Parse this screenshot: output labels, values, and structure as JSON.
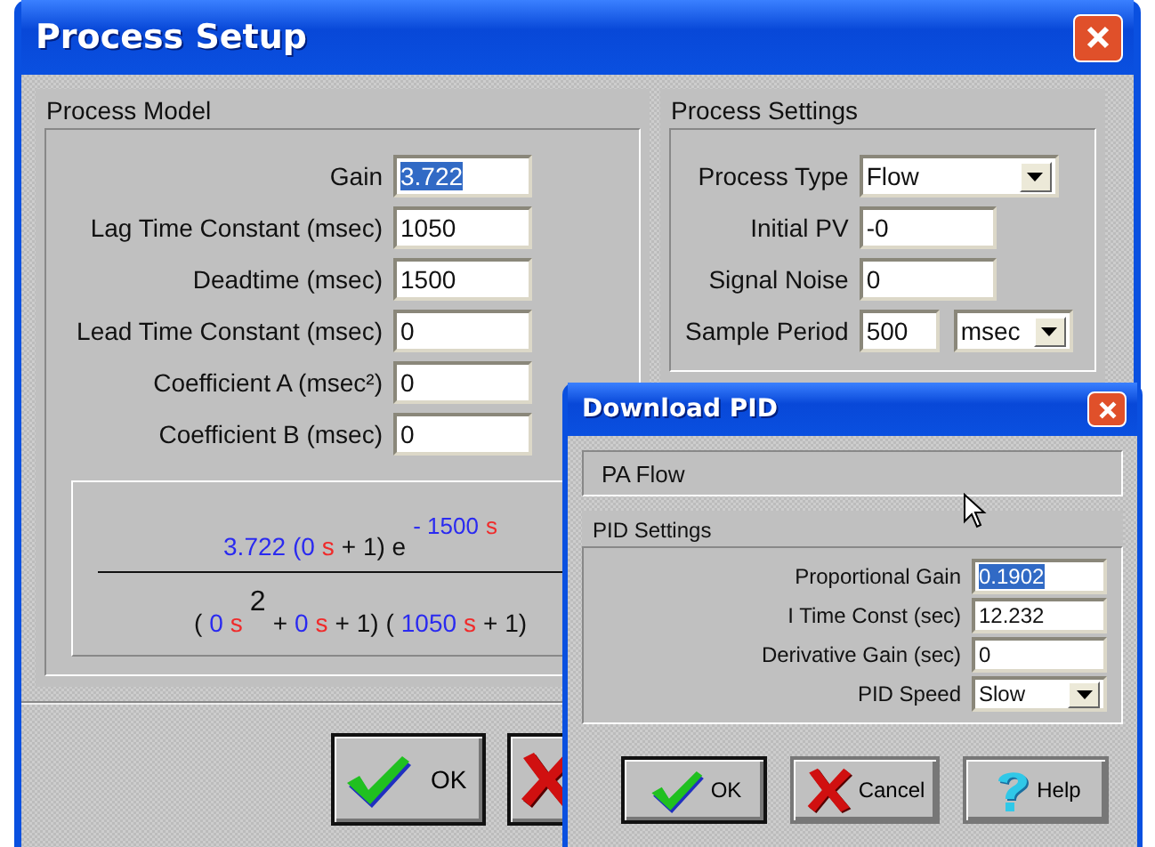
{
  "window": {
    "title": "Process Setup"
  },
  "process_model": {
    "title": "Process Model",
    "fields": [
      {
        "label": "Gain",
        "value": "3.722",
        "selected": true
      },
      {
        "label": "Lag Time Constant (msec)",
        "value": "1050",
        "selected": false
      },
      {
        "label": "Deadtime (msec)",
        "value": "1500",
        "selected": false
      },
      {
        "label": "Lead Time Constant (msec)",
        "value": "0",
        "selected": false
      },
      {
        "label": "Coefficient A (msec²)",
        "value": "0",
        "selected": false
      },
      {
        "label": "Coefficient B (msec)",
        "value": "0",
        "selected": false
      }
    ],
    "formula": {
      "numerator": [
        {
          "text": "3.722 (0",
          "kind": "num",
          "raised": false
        },
        {
          "text": "s",
          "kind": "var",
          "raised": false
        },
        {
          "text": "+ 1) e",
          "kind": "op",
          "raised": false
        },
        {
          "text": "- 1500",
          "kind": "num",
          "raised": true
        },
        {
          "text": "s",
          "kind": "var",
          "raised": true
        }
      ],
      "denominator": [
        {
          "text": "(",
          "kind": "op",
          "raised": false
        },
        {
          "text": "0",
          "kind": "num",
          "raised": false
        },
        {
          "text": "s",
          "kind": "var",
          "raised": false
        },
        {
          "text": "2",
          "kind": "op",
          "raised": true
        },
        {
          "text": "+",
          "kind": "op",
          "raised": false
        },
        {
          "text": "0",
          "kind": "num",
          "raised": false
        },
        {
          "text": "s",
          "kind": "var",
          "raised": false
        },
        {
          "text": "+ 1) (",
          "kind": "op",
          "raised": false
        },
        {
          "text": "1050",
          "kind": "num",
          "raised": false
        },
        {
          "text": "s",
          "kind": "var",
          "raised": false
        },
        {
          "text": "+ 1)",
          "kind": "op",
          "raised": false
        }
      ]
    }
  },
  "process_settings": {
    "title": "Process Settings",
    "fields": [
      {
        "kind": "dropdown",
        "label": "Process Type",
        "value": "Flow"
      },
      {
        "kind": "text",
        "label": "Initial PV",
        "value": "-0"
      },
      {
        "kind": "text",
        "label": "Signal Noise",
        "value": "0"
      },
      {
        "kind": "text_unit",
        "label": "Sample Period",
        "value": "500",
        "unit": "msec"
      }
    ]
  },
  "buttons": [
    {
      "kind": "check",
      "label": "OK"
    },
    {
      "kind": "cross"
    }
  ],
  "dialog": {
    "title": "Download PID",
    "name": "PA Flow",
    "settings_title": "PID Settings",
    "fields": [
      {
        "kind": "text",
        "label": "Proportional Gain",
        "value": "0.1902",
        "selected": true
      },
      {
        "kind": "text",
        "label": "I Time Const (sec)",
        "value": "12.232",
        "selected": false
      },
      {
        "kind": "text",
        "label": "Derivative Gain (sec)",
        "value": "0",
        "selected": false
      },
      {
        "kind": "dropdown",
        "label": "PID Speed",
        "value": "Slow",
        "selected": false
      }
    ],
    "buttons": [
      {
        "kind": "check",
        "label": "OK"
      },
      {
        "kind": "cross",
        "label": "Cancel"
      },
      {
        "kind": "help",
        "label": "Help"
      }
    ]
  }
}
